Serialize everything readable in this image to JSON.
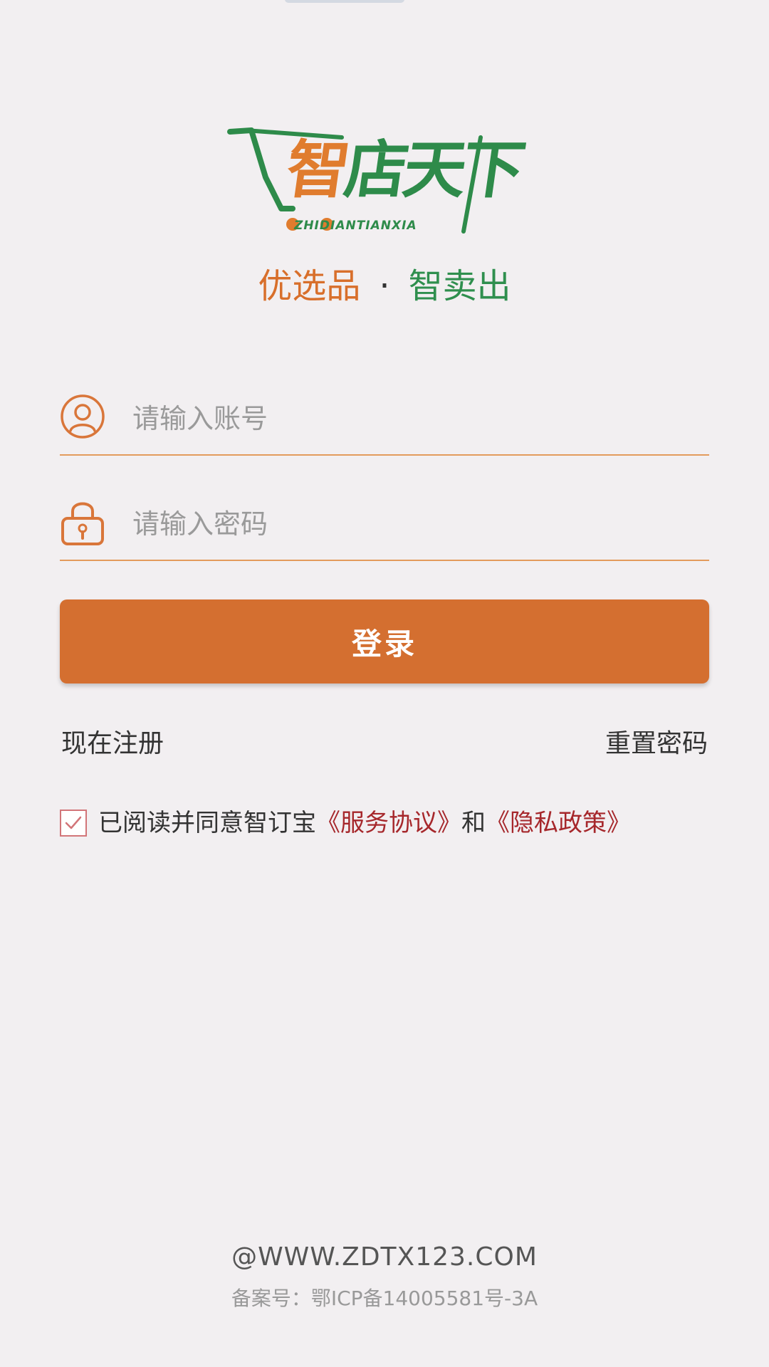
{
  "logo": {
    "char1": "智",
    "char_rest": "店天下",
    "pinyin": "ZHIDIANTIANXIA"
  },
  "slogan": {
    "left": "优选品",
    "separator": "·",
    "right": "智卖出"
  },
  "form": {
    "account_placeholder": "请输入账号",
    "password_placeholder": "请输入密码",
    "login_label": "登录"
  },
  "links": {
    "register": "现在注册",
    "reset_password": "重置密码"
  },
  "agreement": {
    "checked": true,
    "prefix": "已阅读并同意智订宝",
    "service": "《服务协议》",
    "and": "和",
    "privacy": "《隐私政策》"
  },
  "footer": {
    "url": "@WWW.ZDTX123.COM",
    "icp": "备案号：鄂ICP备14005581号-3A"
  },
  "colors": {
    "accent_orange": "#d46f30",
    "brand_green": "#2e8b4a",
    "link_red": "#a6272b"
  }
}
